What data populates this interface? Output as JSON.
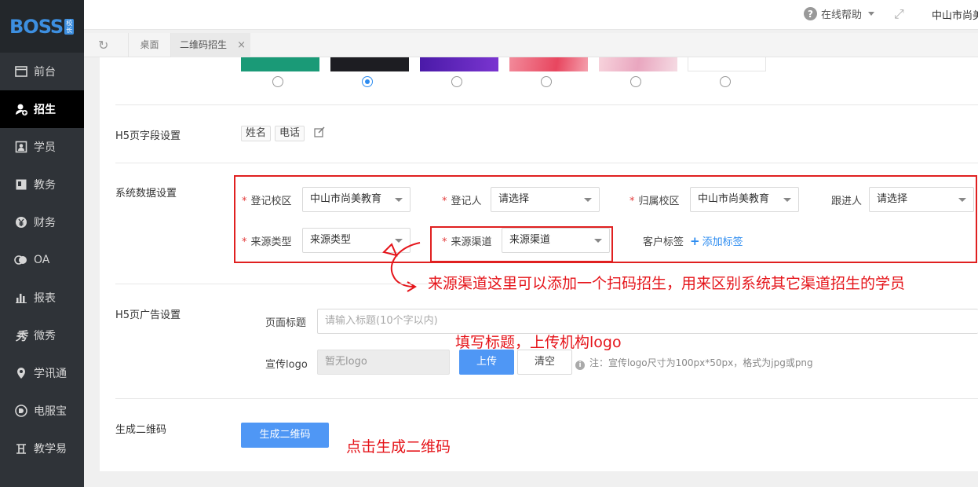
{
  "sidebar": {
    "logo": "BOSS",
    "logo_badge": [
      "校",
      "长"
    ],
    "items": [
      {
        "label": "前台",
        "icon": "window-icon"
      },
      {
        "label": "招生",
        "icon": "add-user-icon"
      },
      {
        "label": "学员",
        "icon": "id-card-icon"
      },
      {
        "label": "教务",
        "icon": "book-icon"
      },
      {
        "label": "财务",
        "icon": "yen-icon"
      },
      {
        "label": "OA",
        "icon": "oa-icon"
      },
      {
        "label": "报表",
        "icon": "bar-chart-icon"
      },
      {
        "label": "微秀",
        "icon": "wechat-show-icon"
      },
      {
        "label": "学讯通",
        "icon": "location-pin-icon"
      },
      {
        "label": "电服宝",
        "icon": "phone-service-icon"
      },
      {
        "label": "教学易",
        "icon": "teach-icon"
      }
    ],
    "active_index": 1
  },
  "topbar": {
    "help": "在线帮助",
    "org": "中山市尚美"
  },
  "tabs": {
    "desk": "桌面",
    "current": "二维码招生",
    "close": "×"
  },
  "themes": {
    "colors": [
      "#1a9a77",
      "#1d1d22",
      "#5a21b5",
      "#ef6d82",
      "#f2c7d4",
      "#ffffff"
    ],
    "selected_index": 1
  },
  "h5_fields": {
    "label": "H5页字段设置",
    "chips": [
      "姓名",
      "电话"
    ]
  },
  "system": {
    "label": "系统数据设置",
    "fields": [
      {
        "label": "登记校区",
        "value": "中山市尚美教育",
        "required": true
      },
      {
        "label": "登记人",
        "value": "请选择",
        "required": true
      },
      {
        "label": "归属校区",
        "value": "中山市尚美教育",
        "required": true
      },
      {
        "label": "跟进人",
        "value": "请选择",
        "required": false
      },
      {
        "label": "来源类型",
        "value": "来源类型",
        "required": true
      },
      {
        "label": "来源渠道",
        "value": "来源渠道",
        "required": true
      }
    ],
    "tag_label": "客户标签",
    "add_tag": "添加标签",
    "required_mark": "*"
  },
  "ad": {
    "label": "H5页广告设置",
    "title_label": "页面标题",
    "title_placeholder": "请输入标题(10个字以内)",
    "logo_label": "宣传logo",
    "logo_value": "暂无logo",
    "upload": "上传",
    "clear": "清空",
    "tip": "注：宣传logo尺寸为100px*50px，格式为jpg或png"
  },
  "qr": {
    "label": "生成二维码",
    "button": "生成二维码"
  },
  "annotations": {
    "source": "来源渠道这里可以添加一个扫码招生，用来区别系统其它渠道招生的学员",
    "title": "填写标题，上传机构logo",
    "generate": "点击生成二维码"
  }
}
